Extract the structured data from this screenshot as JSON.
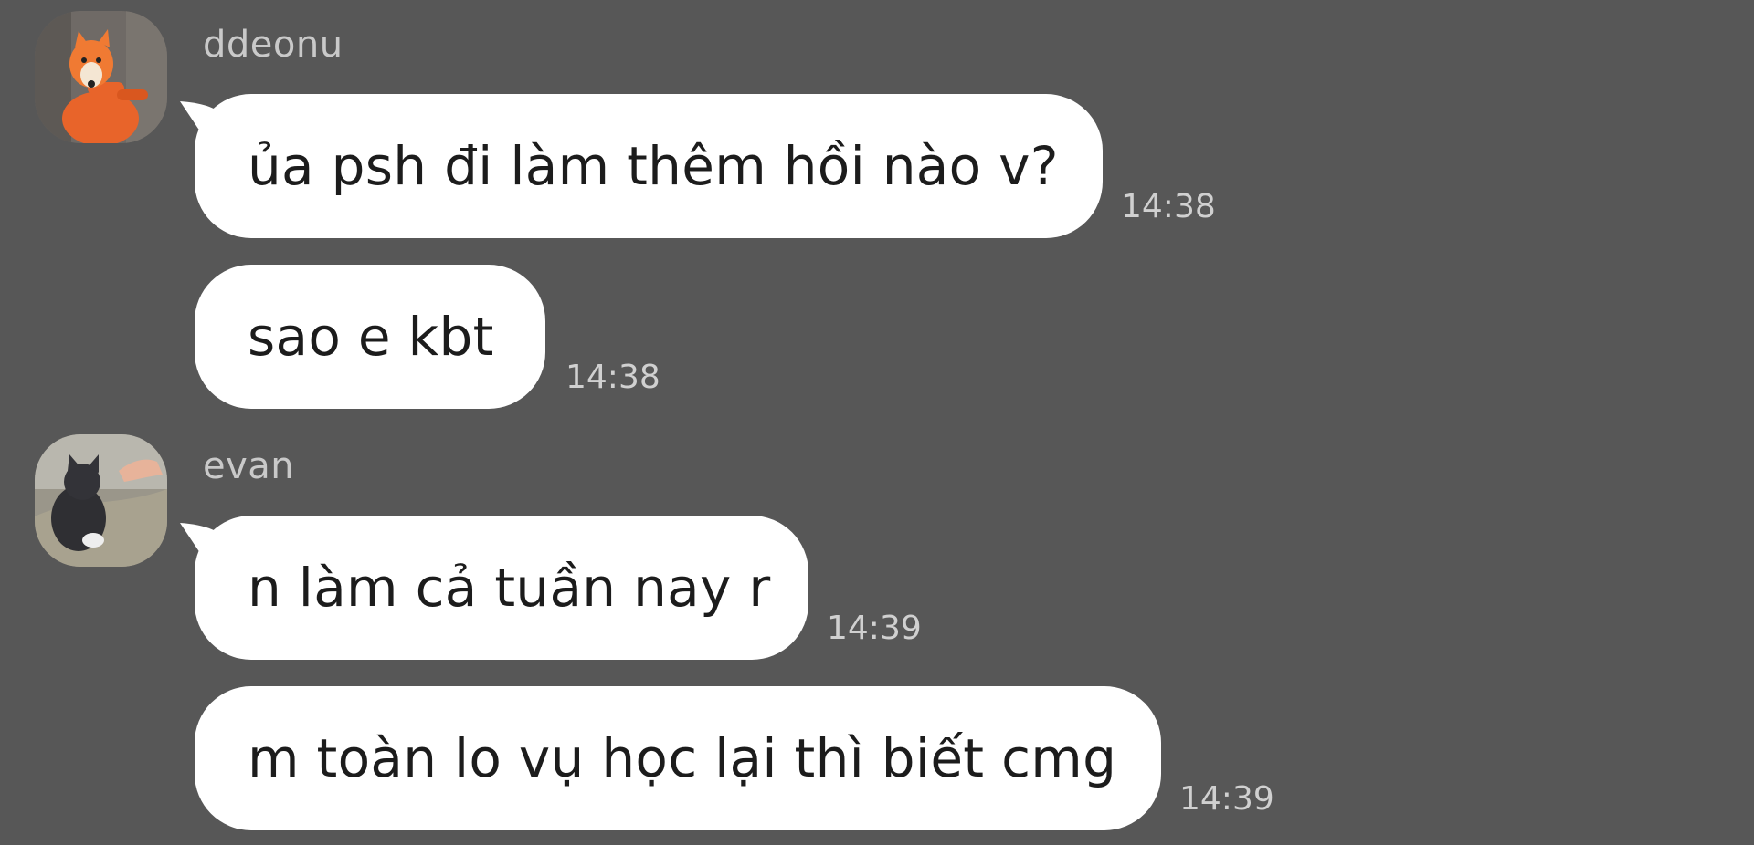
{
  "conversation": {
    "groups": [
      {
        "sender": "ddeonu",
        "avatar_icon": "fox-plush-avatar-icon",
        "messages": [
          {
            "text": "ủa psh đi làm thêm hồi nào v?",
            "time": "14:38"
          },
          {
            "text": "sao e kbt",
            "time": "14:38"
          }
        ]
      },
      {
        "sender": "evan",
        "avatar_icon": "kitten-avatar-icon",
        "messages": [
          {
            "text": "n làm cả tuần nay r",
            "time": "14:39"
          },
          {
            "text": "m toàn lo vụ học lại thì biết cmg",
            "time": "14:39"
          }
        ]
      }
    ]
  },
  "colors": {
    "background": "#575757",
    "bubble": "#ffffff",
    "bubble_text": "#1c1c1c",
    "sender_text": "#c9c9c9",
    "timestamp_text": "#d0d0d0"
  }
}
